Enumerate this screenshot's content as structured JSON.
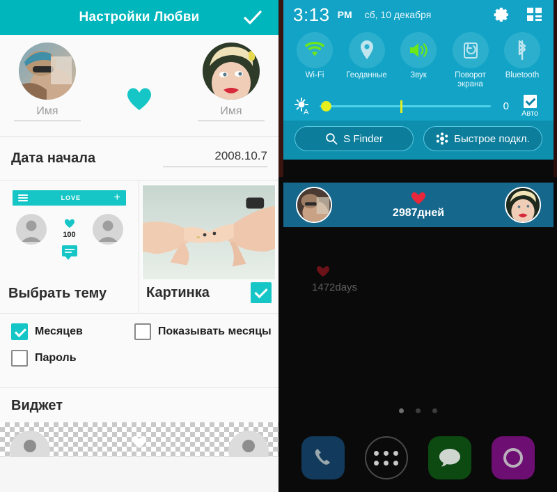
{
  "left_app": {
    "appbar": {
      "title": "Настройки Любви",
      "confirm_icon": "check-icon"
    },
    "profiles": {
      "left_name_placeholder": "Имя",
      "right_name_placeholder": "Имя",
      "heart_icon": "heart-icon",
      "heart_color": "#16c6c6"
    },
    "start_date": {
      "label": "Дата начала",
      "value": "2008.10.7"
    },
    "theme": {
      "preview": {
        "bar_title": "LOVE",
        "menu_icon": "hamburger-icon",
        "add_icon": "plus-icon",
        "counter": "100",
        "heart_icon": "heart-icon",
        "bubble_icon": "chat-bubble-icon"
      },
      "pick_label": "Выбрать тему",
      "picture_label": "Картинка",
      "picture_checked": true
    },
    "checkboxes": [
      {
        "label": "Месяцев",
        "checked": true
      },
      {
        "label": "Показывать месяцы",
        "checked": false
      },
      {
        "label": "Пароль",
        "checked": false
      }
    ],
    "widget": {
      "title": "Виджет",
      "heart_icon": "heart-icon"
    },
    "accent_color": "#00b6bd"
  },
  "phone": {
    "statusbar": {
      "time": "3:13",
      "ampm": "PM",
      "date": "сб, 10 декабря",
      "settings_icon": "gear-icon",
      "edit_icon": "grid-edit-icon"
    },
    "quick_toggles": [
      {
        "label": "Wi-Fi",
        "icon": "wifi-icon",
        "active": true
      },
      {
        "label": "Геоданные",
        "icon": "location-pin-icon",
        "active": false
      },
      {
        "label": "Звук",
        "icon": "speaker-icon",
        "active": true
      },
      {
        "label": "Поворот экрана",
        "icon": "rotate-screen-icon",
        "active": false
      },
      {
        "label": "Bluetooth",
        "icon": "bluetooth-icon",
        "active": false
      }
    ],
    "brightness": {
      "icon": "brightness-auto-icon",
      "value": "0",
      "auto_label": "Авто",
      "auto_checked": true
    },
    "buttons": [
      {
        "label": "S Finder",
        "icon": "search-icon"
      },
      {
        "label": "Быстрое подкл.",
        "icon": "quick-connect-icon"
      }
    ],
    "notification_widget": {
      "days": "2987дней",
      "heart_icon": "heart-icon",
      "background": "#16678c"
    },
    "home_widget": {
      "days": "1472days",
      "heart_icon": "heart-icon"
    },
    "page_dots": {
      "count": 3,
      "active_index": 0
    },
    "dock": [
      {
        "name": "phone",
        "icon": "phone-icon",
        "color": "#123a5c"
      },
      {
        "name": "app-drawer",
        "icon": "app-drawer-icon",
        "color": "#000000"
      },
      {
        "name": "messages",
        "icon": "message-icon",
        "color": "#0d4a12"
      },
      {
        "name": "camera",
        "icon": "camera-icon",
        "color": "#6d0f72"
      }
    ],
    "panel_color": "#12a3c6"
  }
}
